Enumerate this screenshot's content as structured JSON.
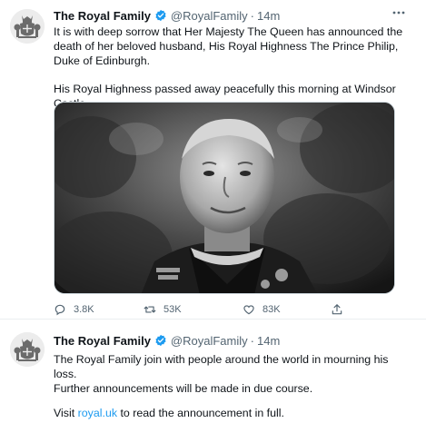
{
  "tweets": [
    {
      "author_name": "The Royal Family",
      "handle": "@RoyalFamily",
      "separator": "·",
      "time": "14m",
      "paragraphs": [
        "It is with deep sorrow that Her Majesty The Queen has announced the death of her beloved husband, His Royal Highness The Prince Philip, Duke of Edinburgh.",
        "His Royal Highness passed away peacefully this morning at Windsor Castle."
      ],
      "actions": {
        "replies": "3.8K",
        "retweets": "53K",
        "likes": "83K"
      }
    },
    {
      "author_name": "The Royal Family",
      "handle": "@RoyalFamily",
      "separator": "·",
      "time": "14m",
      "paragraphs": [
        "The Royal Family join with people around the world in mourning his loss.",
        "Further announcements will be made in due course."
      ],
      "visit_prefix": "Visit ",
      "visit_link": "royal.uk",
      "visit_suffix": " to read the announcement in full."
    }
  ],
  "icons": {
    "verified": "verified-badge-icon",
    "more": "more-horizontal-icon",
    "reply": "reply-icon",
    "retweet": "retweet-icon",
    "like": "heart-icon",
    "share": "share-icon"
  },
  "colors": {
    "verified_blue": "#1d9bf0",
    "secondary_text": "#536471",
    "link": "#1d9bf0"
  }
}
